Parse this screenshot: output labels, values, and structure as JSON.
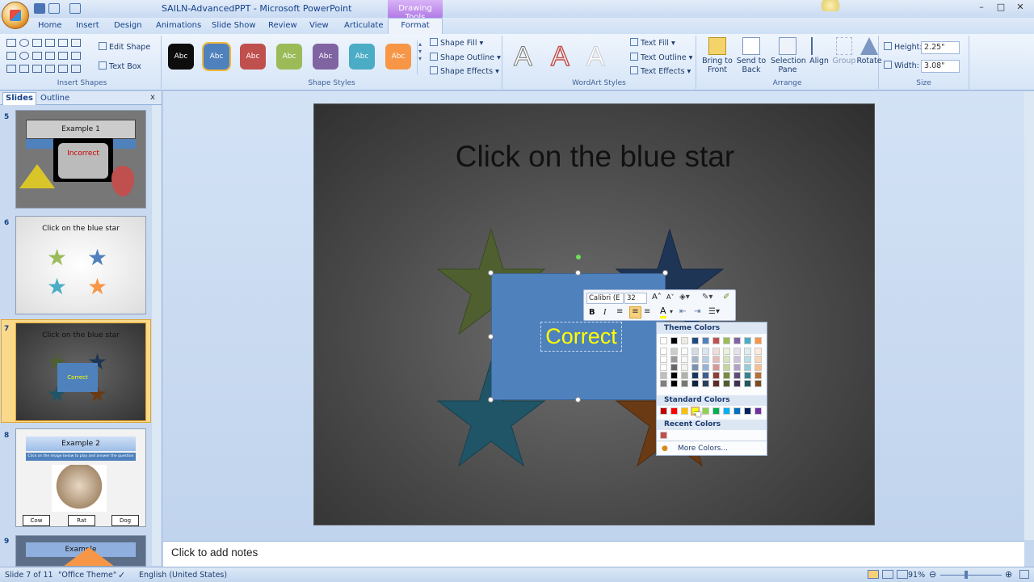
{
  "window": {
    "title": "SAILN-AdvancedPPT - Microsoft PowerPoint",
    "context_tab": "Drawing Tools",
    "controls": [
      "–",
      "□",
      "✕"
    ]
  },
  "tabs": [
    "Home",
    "Insert",
    "Design",
    "Animations",
    "Slide Show",
    "Review",
    "View",
    "Articulate",
    "Format"
  ],
  "ribbon": {
    "insert_shapes": {
      "label": "Insert Shapes",
      "edit_shape": "Edit Shape",
      "text_box": "Text Box"
    },
    "shape_styles": {
      "label": "Shape Styles",
      "samples": [
        {
          "text": "Abc",
          "color": "#0d0d0d"
        },
        {
          "text": "Abc",
          "color": "#4f81bd"
        },
        {
          "text": "Abc",
          "color": "#c0504d"
        },
        {
          "text": "Abc",
          "color": "#9bbb59"
        },
        {
          "text": "Abc",
          "color": "#8064a2"
        },
        {
          "text": "Abc",
          "color": "#4bacc6"
        },
        {
          "text": "Abc",
          "color": "#f79646"
        }
      ],
      "shape_fill": "Shape Fill",
      "shape_outline": "Shape Outline",
      "shape_effects": "Shape Effects"
    },
    "wordart_styles": {
      "label": "WordArt Styles",
      "text_fill": "Text Fill",
      "text_outline": "Text Outline",
      "text_effects": "Text Effects"
    },
    "arrange": {
      "label": "Arrange",
      "bring_to_front": [
        "Bring to",
        "Front"
      ],
      "send_to_back": [
        "Send to",
        "Back"
      ],
      "selection_pane": [
        "Selection",
        "Pane"
      ],
      "align": "Align",
      "group": "Group",
      "rotate": "Rotate"
    },
    "size": {
      "label": "Size",
      "height_label": "Height:",
      "height": "2.25\"",
      "width_label": "Width:",
      "width": "3.08\""
    }
  },
  "panel": {
    "tabs": [
      "Slides",
      "Outline"
    ],
    "close": "x",
    "thumbnails": [
      {
        "num": "5",
        "title": "Example 1",
        "caption": "Incorrect"
      },
      {
        "num": "6",
        "title": "Click on the blue star"
      },
      {
        "num": "7",
        "title": "Click on the blue star",
        "caption": "Correct"
      },
      {
        "num": "8",
        "title": "Example 2",
        "sub": "Click on the image below to play and answer the question",
        "answers": [
          "Cow",
          "Rat",
          "Dog"
        ]
      },
      {
        "num": "9",
        "title": "Example"
      }
    ]
  },
  "slide": {
    "title": "Click on the blue star",
    "box_text": "Correct",
    "colors": {
      "box": "#4f81bd",
      "text": "#ffff00",
      "background": "#4a4a4a"
    }
  },
  "mini_toolbar": {
    "font": "Calibri (E",
    "size": "32",
    "bold": "B",
    "italic": "I"
  },
  "color_picker": {
    "theme_colors": "Theme Colors",
    "standard_colors": "Standard Colors",
    "recent_colors": "Recent Colors",
    "more_colors": "More Colors...",
    "theme_top": [
      "#ffffff",
      "#000000",
      "#eeece1",
      "#1f497d",
      "#4f81bd",
      "#c0504d",
      "#9bbb59",
      "#8064a2",
      "#4bacc6",
      "#f79646"
    ],
    "standard": [
      "#c00000",
      "#ff0000",
      "#ffc000",
      "#ffff00",
      "#92d050",
      "#00b050",
      "#00b0f0",
      "#0070c0",
      "#002060",
      "#7030a0"
    ],
    "recent": [
      "#c0504d"
    ]
  },
  "notes": {
    "placeholder": "Click to add notes"
  },
  "status": {
    "slide": "Slide 7 of 11",
    "theme": "\"Office Theme\"",
    "language": "English (United States)",
    "zoom": "91%"
  }
}
